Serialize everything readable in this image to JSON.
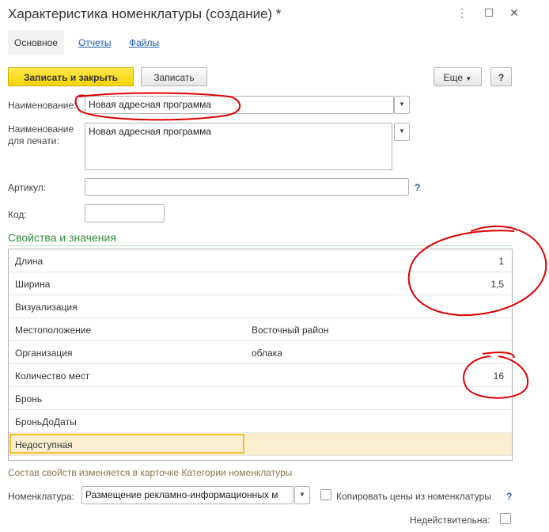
{
  "window": {
    "title": "Характеристика номенклатуры (создание) *"
  },
  "tabs": [
    {
      "label": "Основное"
    },
    {
      "label": "Отчеты"
    },
    {
      "label": "Файлы"
    }
  ],
  "toolbar": {
    "save_close_label": "Записать и закрыть",
    "save_label": "Записать",
    "more_label": "Еще",
    "help_label": "?"
  },
  "form": {
    "name_label": "Наименование:",
    "name_value": "Новая адресная программа",
    "print_name_label_1": "Наименование",
    "print_name_label_2": "для печати:",
    "print_name_value": "Новая адресная программа",
    "article_label": "Артикул:",
    "article_value": "",
    "article_help": "?",
    "code_label": "Код:",
    "code_value": ""
  },
  "properties": {
    "section_title": "Свойства и значения",
    "rows": [
      {
        "name": "Длина",
        "value": "1",
        "align": "right"
      },
      {
        "name": "Ширина",
        "value": "1,5",
        "align": "right"
      },
      {
        "name": "Визуализация",
        "value": "",
        "align": "left"
      },
      {
        "name": "Местоположение",
        "value": "Восточный район",
        "align": "left"
      },
      {
        "name": "Организация",
        "value": "облака",
        "align": "left"
      },
      {
        "name": "Количество мест",
        "value": "16",
        "align": "right"
      },
      {
        "name": "Бронь",
        "value": "",
        "align": "left"
      },
      {
        "name": "БроньДоДаты",
        "value": "",
        "align": "left"
      },
      {
        "name": "Недоступная",
        "value": "",
        "align": "left",
        "selected": true
      }
    ],
    "note": "Состав свойств изменяется в карточке Категории номенклатуры"
  },
  "bottom": {
    "nomenclature_label": "Номенклатура:",
    "nomenclature_value": "Размещение рекламно-информационных м",
    "copy_prices_label": "Копировать цены из номенклатуры",
    "copy_prices_help": "?",
    "inactive_label": "Недействительна:"
  },
  "colors": {
    "accent_yellow": "#f5d400",
    "section_green": "#2f8f3a",
    "link_blue": "#1f5ba8",
    "annotation_red": "#e00000",
    "selection": "#fcefd1"
  }
}
